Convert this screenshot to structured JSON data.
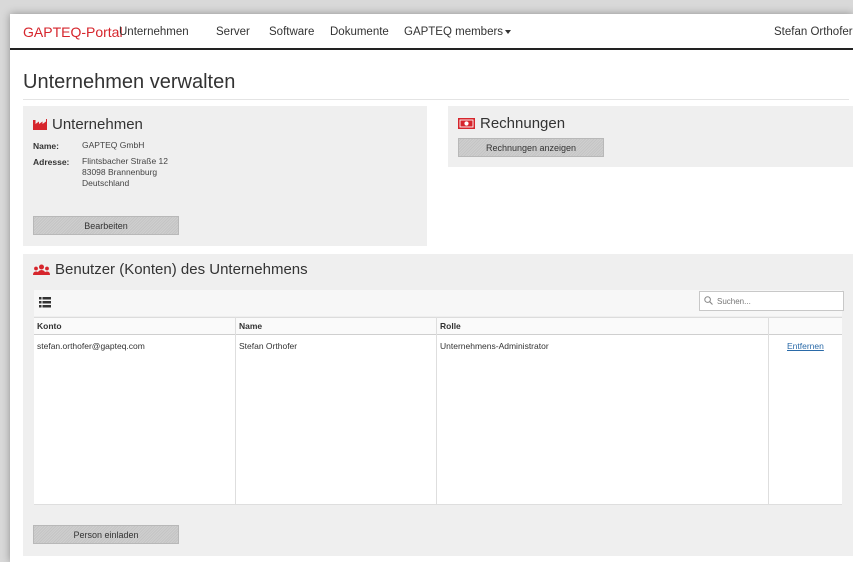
{
  "navbar": {
    "brand": "GAPTEQ-Portal",
    "items": [
      "Unternehmen",
      "Server",
      "Software",
      "Dokumente",
      "GAPTEQ members"
    ],
    "user": "Stefan Orthofer"
  },
  "page": {
    "title": "Unternehmen verwalten"
  },
  "company_panel": {
    "heading": "Unternehmen",
    "name_label": "Name:",
    "name_value": "GAPTEQ GmbH",
    "address_label": "Adresse:",
    "address_lines": [
      "Flintsbacher Straße 12",
      "83098 Brannenburg",
      "Deutschland"
    ],
    "edit_button": "Bearbeiten"
  },
  "invoices_panel": {
    "heading": "Rechnungen",
    "show_button": "Rechnungen anzeigen"
  },
  "users_panel": {
    "heading": "Benutzer (Konten) des Unternehmens",
    "search_placeholder": "Suchen...",
    "columns": [
      "Konto",
      "Name",
      "Rolle"
    ],
    "rows": [
      {
        "konto": "stefan.orthofer@gapteq.com",
        "name": "Stefan Orthofer",
        "rolle": "Unternehmens-Administrator",
        "action": "Entfernen"
      }
    ],
    "invite_button": "Person einladen"
  },
  "colors": {
    "brand": "#d6252c",
    "panel": "#efefef",
    "link": "#2a6aa8"
  },
  "icons": {
    "company": "factory-icon",
    "invoices": "banknote-icon",
    "users": "users-icon",
    "list": "list-icon",
    "search": "search-icon"
  }
}
